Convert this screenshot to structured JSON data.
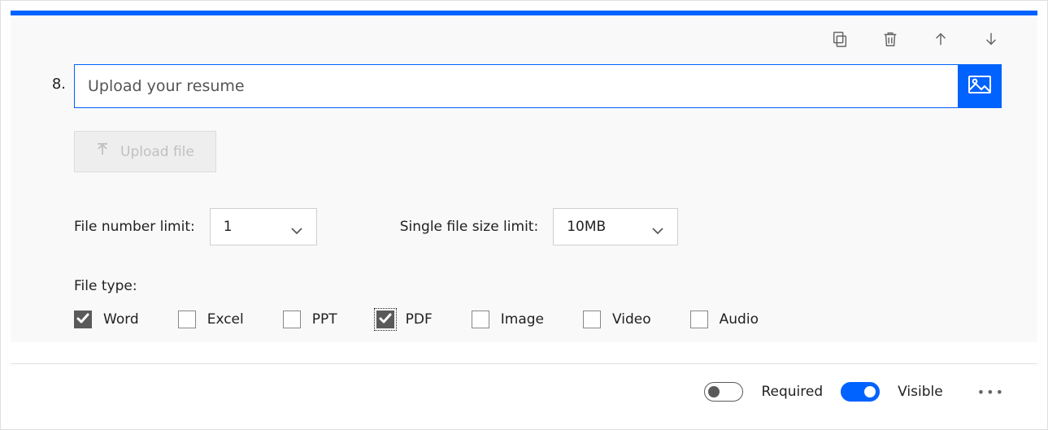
{
  "question_number": "8.",
  "question_text": "Upload your resume",
  "upload_button_label": "Upload file",
  "limits": {
    "file_number_label": "File number limit:",
    "file_number_value": "1",
    "size_label": "Single file size limit:",
    "size_value": "10MB"
  },
  "filetype": {
    "label": "File type:",
    "options": [
      {
        "key": "word",
        "label": "Word",
        "checked": true,
        "focused": false
      },
      {
        "key": "excel",
        "label": "Excel",
        "checked": false,
        "focused": false
      },
      {
        "key": "ppt",
        "label": "PPT",
        "checked": false,
        "focused": false
      },
      {
        "key": "pdf",
        "label": "PDF",
        "checked": true,
        "focused": true
      },
      {
        "key": "image",
        "label": "Image",
        "checked": false,
        "focused": false
      },
      {
        "key": "video",
        "label": "Video",
        "checked": false,
        "focused": false
      },
      {
        "key": "audio",
        "label": "Audio",
        "checked": false,
        "focused": false
      }
    ]
  },
  "footer": {
    "required_label": "Required",
    "required_on": false,
    "visible_label": "Visible",
    "visible_on": true
  }
}
